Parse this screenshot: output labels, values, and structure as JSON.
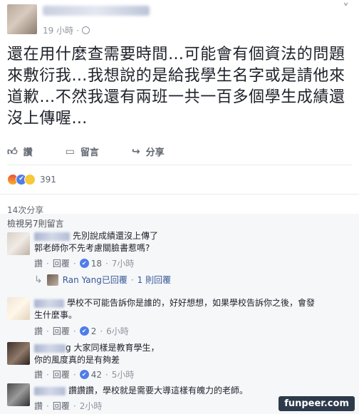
{
  "post": {
    "time": "19 小時",
    "dot": "·",
    "text": "還在用什麼查需要時間…可能會有個資法的問題來敷衍我…我想說的是給我學生名字或是請他來道歉…不然我還有兩班一共一百多個學生成績還沒上傳喔…",
    "actions": {
      "like": "讚",
      "comment": "留言",
      "share": "分享"
    },
    "reaction_count": "391",
    "shares": "14次分享"
  },
  "comments_section": {
    "view_more": "檢視另7則留言",
    "comments": [
      {
        "name_visible": "",
        "text_line1": "先別說成績還沒上傳了",
        "text_line2": "郭老師你不先考慮關臉書惹嗎?",
        "like": "讚",
        "reply": "回覆",
        "likes": "18",
        "time": "7小時",
        "reply_user": "Ran Yang已回覆",
        "reply_count": "1 則回覆"
      },
      {
        "name_visible": "",
        "text_line1": "學校不可能告訴你是誰的，好好想想，如果學校告訴你之後，會發",
        "text_line2": "生什麼事。",
        "like": "讚",
        "reply": "回覆",
        "likes": "2",
        "time": "6小時"
      },
      {
        "name_visible": "g",
        "text_line1": "大家同樣是教育學生，",
        "text_line2": "你的風度真的是有夠差",
        "like": "讚",
        "reply": "回覆",
        "likes": "42",
        "time": "5小時"
      },
      {
        "name_visible": "",
        "text_line1": "讚讚讚，學校就是需要大導這樣有魄力的老師。",
        "like": "讚",
        "reply": "回覆",
        "time": "2小時"
      }
    ]
  },
  "watermark": "funpeer.com",
  "colors": {
    "link": "#365899",
    "like_blue": "#4f7de8",
    "muted": "#90949c"
  }
}
